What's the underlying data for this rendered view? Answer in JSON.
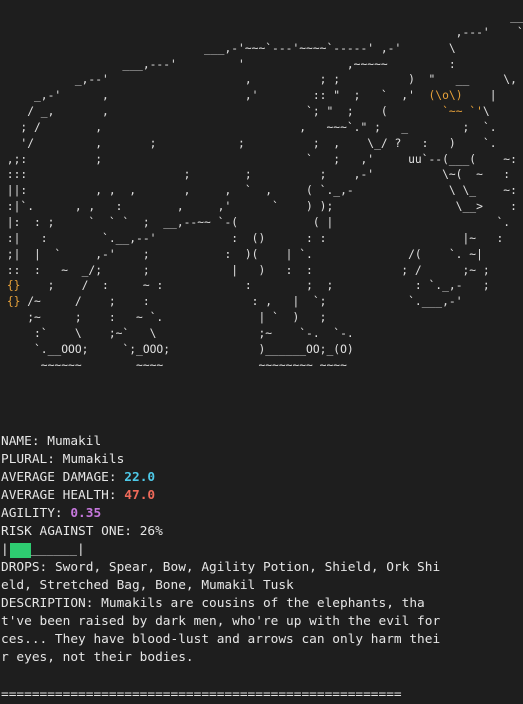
{
  "art_lines": [
    "                                                                           ___",
    "                                                                   ,---'    `-.",
    "                              ___,-'~~~`---'~~~~`-----' ,-'       \\",
    "                  ___,---'         '               ,~~~~~         :",
    "           _,--'                    ,          ; ;          )  \"   __     \\,",
    "     _,-'      ,                    ,'        :: \"  ;   `  ,'  (\\o\\)    |",
    "    / _,       ,                             `; \"  ;    (        `~~ `'\\",
    "   ; /        ,                             ,   ~~~`.\" ;   _        ;  `.",
    "   '/         ,       ;            ;          ;  ,    \\_/ ?   :   )    `.",
    " ,;:          ;                              `   ;   ,'     uu`--(___(    ~:",
    " :::                       ;        ;          ;    ,-'          \\~(  ~   :",
    " ||:          , ,  ,       ,     ,  `  ,     ( `._,-              \\ \\_    ~:",
    " :|`.      , ,   :        ,     ,'      `    ) );                  \\__>    :",
    " |:  : ;     `  ` `  ;  __,--~~ `-(           ( |                        `.  ~|",
    " :|   :        `.__,--'           :  ()      : :                    |~   :",
    " ;|  |  `     ,-'    ;           :  )(    | `.              /(    `. ~|",
    " ::  :   ~  _/;      ;            |   )   :  :             ; /      ;~ ;",
    " {}    ;    /  :     ~ :            :        ;  ;            : `._,-   ;",
    " {} /~     /    ;    :               : ,   |  `;            `.___,-'",
    "    ;~     ;    :   ~ `.              | `  )   ;",
    "     :`    \\    ;~`   \\               ;~    `-.  `-.",
    "     `.__OOO;     `;_OOO;             )______OO;_(O)",
    "      ~~~~~~        ~~~~              ~~~~~~~~ ~~~~"
  ],
  "accent_colors": {
    "eye": "#e8a23a",
    "tusk": "#e8a23a",
    "damage": "#4ec9e8",
    "health": "#f06a5a",
    "agility": "#c678dd",
    "bar": "#2ecc71"
  },
  "monster": {
    "name_label": "NAME: ",
    "name_value": "Mumakil",
    "plural_label": "PLURAL: ",
    "plural_value": "Mumakils",
    "damage_label": "AVERAGE DAMAGE: ",
    "damage_value": "22.0",
    "health_label": "AVERAGE HEALTH: ",
    "health_value": "47.0",
    "agility_label": "AGILITY: ",
    "agility_value": "0.35",
    "risk_label": "RISK AGAINST ONE: ",
    "risk_value": "26%",
    "risk_fraction": 0.26,
    "bar_left": "|",
    "bar_rest": "______|",
    "drops_label": "DROPS: ",
    "drops_value": "Sword, Spear, Bow, Agility Potion, Shield, Ork Shield, Stretched Bag, Bone, Mumakil Tusk",
    "description_label": "DESCRIPTION: ",
    "description_value": "Mumakils are cousins of the elephants, that've been raised by dark men, who're up with the evil forces... They have blood-lust and arrows can only harm their eyes, not their bodies."
  },
  "separator": "===================================================="
}
